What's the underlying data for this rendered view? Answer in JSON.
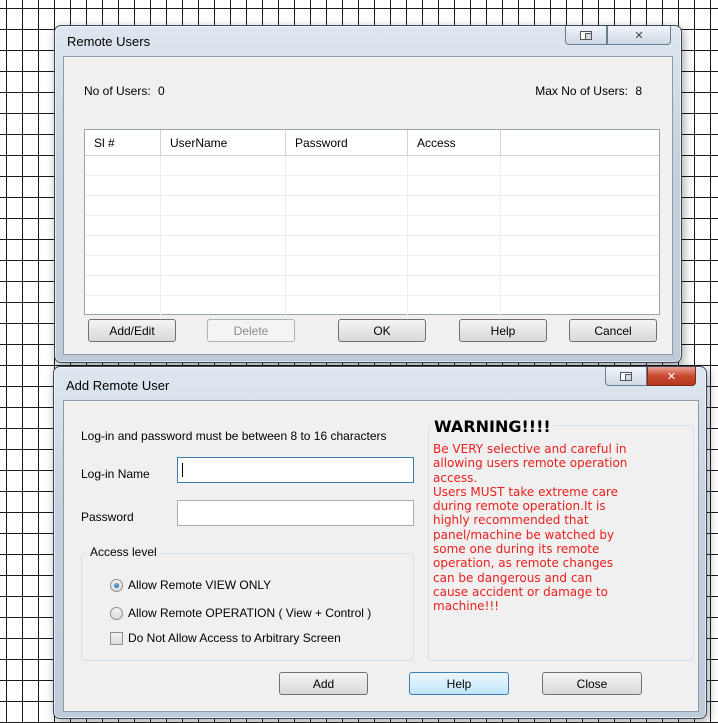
{
  "remote_users": {
    "title": "Remote Users",
    "no_of_users_label": "No of Users:",
    "no_of_users": "0",
    "max_users_label": "Max No of Users:",
    "max_users": "8",
    "columns": [
      "Sl #",
      "UserName",
      "Password",
      "Access"
    ],
    "rows": [],
    "buttons": {
      "add_edit": "Add/Edit",
      "delete": "Delete",
      "ok": "OK",
      "help": "Help",
      "cancel": "Cancel"
    }
  },
  "add_remote_user": {
    "title": "Add Remote User",
    "hint": "Log-in and password must be between 8 to 16 characters",
    "login_label": "Log-in Name",
    "login_value": "",
    "password_label": "Password",
    "password_value": "",
    "access_level_label": "Access level",
    "options": {
      "view_only": "Allow Remote VIEW ONLY",
      "operation": "Allow Remote OPERATION ( View + Control )",
      "no_arbitrary": "Do Not Allow Access to Arbitrary Screen"
    },
    "selected_access": "view_only",
    "no_arbitrary_checked": false,
    "warning_title": "WARNING!!!!",
    "warning_text": "Be VERY selective and careful in\nallowing users remote operation\naccess.\nUsers MUST take extreme care\nduring remote operation.It is\nhighly recommended that\npanel/machine be watched by\nsome one during its remote\noperation, as remote changes\ncan be dangerous and can\ncause accident or damage to\nmachine!!!",
    "buttons": {
      "add": "Add",
      "help": "Help",
      "close": "Close"
    }
  },
  "colors": {
    "warning_text": "#e8201e",
    "close_button": "#c94a32"
  }
}
